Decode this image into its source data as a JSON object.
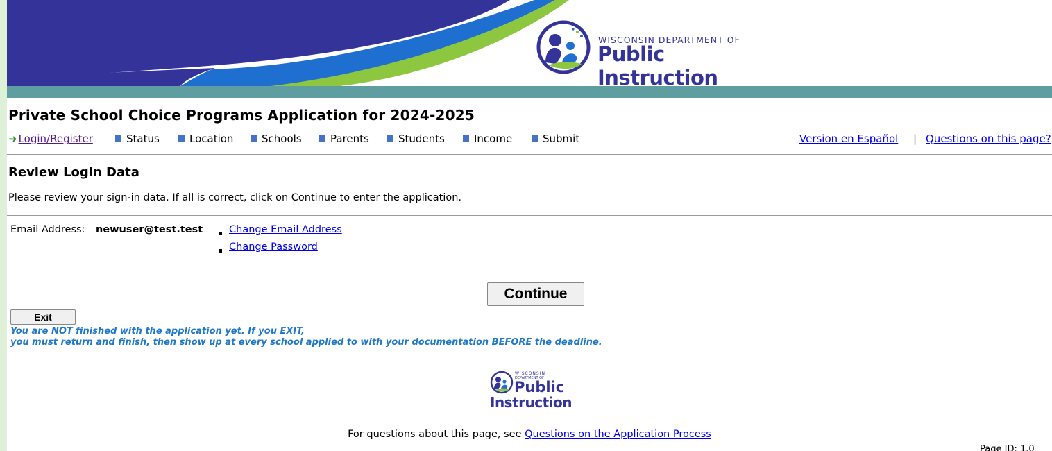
{
  "header": {
    "agency_line1": "WISCONSIN DEPARTMENT OF",
    "agency_line2": "Public Instruction"
  },
  "page_title": "Private School Choice Programs Application for 2024-2025",
  "nav": {
    "current": "Login/Register",
    "steps": [
      "Status",
      "Location",
      "Schools",
      "Parents",
      "Students",
      "Income",
      "Submit"
    ],
    "spanish_link": "Version en Español",
    "separator": "|",
    "questions_link": "Questions on this page?"
  },
  "review": {
    "title": "Review Login Data",
    "intro": "Please review your sign-in data. If all is correct, click on Continue to enter the application.",
    "email_label": "Email Address:",
    "email_value": "newuser@test.test",
    "change_email": "Change Email Address",
    "change_password": "Change Password"
  },
  "buttons": {
    "continue": "Continue",
    "exit": "Exit"
  },
  "warning": {
    "line1": "You are NOT finished with the application yet. If you EXIT,",
    "line2": "you must return and finish, then show up at every school applied to with your documentation BEFORE the deadline."
  },
  "footer": {
    "logo_line1": "WISCONSIN",
    "logo_line2": "DEPARTMENT OF",
    "logo_line3": "Public",
    "logo_line4": "Instruction",
    "questions_prefix": "For questions about this page, see",
    "questions_link": "Questions on the Application Process",
    "page_id": "Page ID: 1.0"
  },
  "colors": {
    "banner_blue": "#343399",
    "swoosh_blue": "#1f6fd1",
    "swoosh_green": "#8dc63f",
    "teal_bar": "#5f9ea0",
    "nav_square": "#4472c4",
    "warning_text": "#1f78c8",
    "side_background": "#dff0d8"
  }
}
